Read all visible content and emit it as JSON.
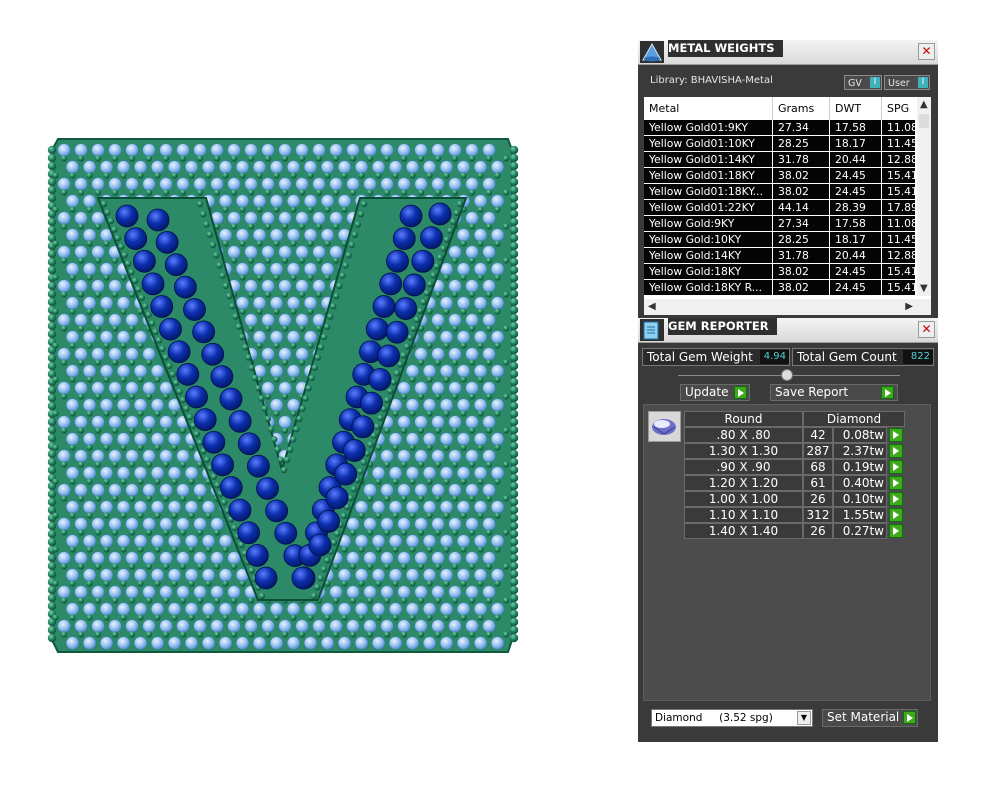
{
  "metal_weights": {
    "title": "METAL WEIGHTS",
    "library": "Library: BHAVISHA-Metal",
    "toggle_gv": "GV",
    "toggle_user": "User",
    "columns": [
      "Metal",
      "Grams",
      "DWT",
      "SPG"
    ],
    "rows": [
      [
        "Yellow Gold01:9KY",
        "27.34",
        "17.58",
        "11.08"
      ],
      [
        "Yellow Gold01:10KY",
        "28.25",
        "18.17",
        "11.45"
      ],
      [
        "Yellow Gold01:14KY",
        "31.78",
        "20.44",
        "12.88"
      ],
      [
        "Yellow Gold01:18KY",
        "38.02",
        "24.45",
        "15.41"
      ],
      [
        "Yellow Gold01:18KY...",
        "38.02",
        "24.45",
        "15.41"
      ],
      [
        "Yellow Gold01:22KY",
        "44.14",
        "28.39",
        "17.89"
      ],
      [
        "Yellow Gold:9KY",
        "27.34",
        "17.58",
        "11.08"
      ],
      [
        "Yellow Gold:10KY",
        "28.25",
        "18.17",
        "11.45"
      ],
      [
        "Yellow Gold:14KY",
        "31.78",
        "20.44",
        "12.88"
      ],
      [
        "Yellow Gold:18KY",
        "38.02",
        "24.45",
        "15.41"
      ],
      [
        "Yellow Gold:18KY R...",
        "38.02",
        "24.45",
        "15.41"
      ]
    ]
  },
  "gem_reporter": {
    "title": "GEM REPORTER",
    "total_weight_label": "Total Gem Weight",
    "total_weight": "4.94",
    "total_count_label": "Total Gem Count",
    "total_count": "822",
    "update_label": "Update",
    "save_label": "Save Report",
    "shape": "Round",
    "material": "Diamond",
    "gems": [
      {
        "size": ".80 X .80",
        "count": "42",
        "weight": "0.08tw"
      },
      {
        "size": "1.30 X 1.30",
        "count": "287",
        "weight": "2.37tw"
      },
      {
        "size": ".90 X .90",
        "count": "68",
        "weight": "0.19tw"
      },
      {
        "size": "1.20 X 1.20",
        "count": "61",
        "weight": "0.40tw"
      },
      {
        "size": "1.00 X 1.00",
        "count": "26",
        "weight": "0.10tw"
      },
      {
        "size": "1.10 X 1.10",
        "count": "312",
        "weight": "1.55tw"
      },
      {
        "size": "1.40 X 1.40",
        "count": "26",
        "weight": "0.27tw"
      }
    ],
    "material_select": "Diamond     (3.52 spg)",
    "set_material_label": "Set Material"
  },
  "colors": {
    "metal_green": "#1f7a5a",
    "stone_light_blue": "#9cc4f0",
    "stone_dark_blue": "#0a2a9a",
    "panel_bg": "#3a3a3a",
    "accent_cyan": "#4fd0d8",
    "go_green": "#3daa1a"
  }
}
